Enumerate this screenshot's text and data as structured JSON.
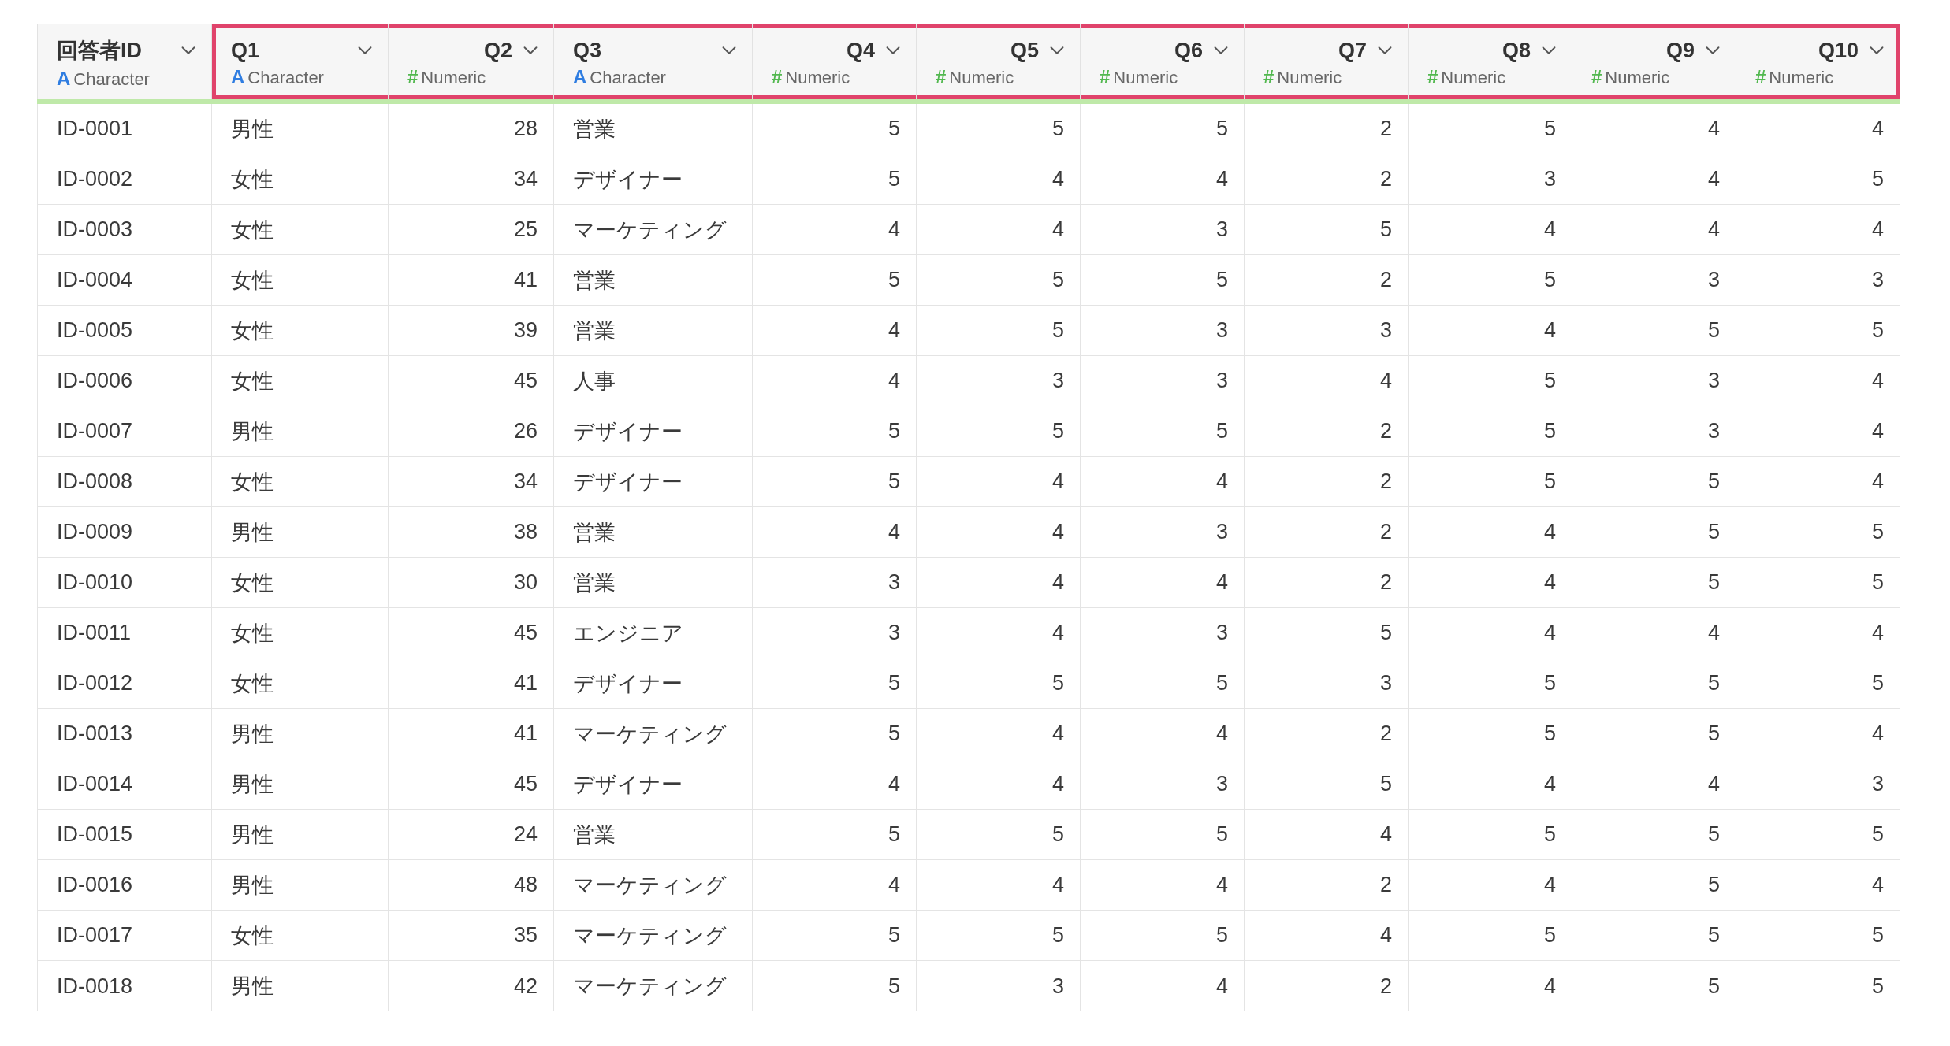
{
  "table": {
    "columns": [
      {
        "name": "回答者ID",
        "kind": "character",
        "type_icon": "A",
        "type": "Character",
        "highlighted": false
      },
      {
        "name": "Q1",
        "kind": "character",
        "type_icon": "A",
        "type": "Character",
        "highlighted": true
      },
      {
        "name": "Q2",
        "kind": "numeric",
        "type_icon": "#",
        "type": "Numeric",
        "highlighted": true
      },
      {
        "name": "Q3",
        "kind": "character",
        "type_icon": "A",
        "type": "Character",
        "highlighted": true
      },
      {
        "name": "Q4",
        "kind": "numeric",
        "type_icon": "#",
        "type": "Numeric",
        "highlighted": true
      },
      {
        "name": "Q5",
        "kind": "numeric",
        "type_icon": "#",
        "type": "Numeric",
        "highlighted": true
      },
      {
        "name": "Q6",
        "kind": "numeric",
        "type_icon": "#",
        "type": "Numeric",
        "highlighted": true
      },
      {
        "name": "Q7",
        "kind": "numeric",
        "type_icon": "#",
        "type": "Numeric",
        "highlighted": true
      },
      {
        "name": "Q8",
        "kind": "numeric",
        "type_icon": "#",
        "type": "Numeric",
        "highlighted": true
      },
      {
        "name": "Q9",
        "kind": "numeric",
        "type_icon": "#",
        "type": "Numeric",
        "highlighted": true
      },
      {
        "name": "Q10",
        "kind": "numeric",
        "type_icon": "#",
        "type": "Numeric",
        "highlighted": true
      }
    ],
    "rows": [
      [
        "ID-0001",
        "男性",
        "28",
        "営業",
        "5",
        "5",
        "5",
        "2",
        "5",
        "4",
        "4"
      ],
      [
        "ID-0002",
        "女性",
        "34",
        "デザイナー",
        "5",
        "4",
        "4",
        "2",
        "3",
        "4",
        "5"
      ],
      [
        "ID-0003",
        "女性",
        "25",
        "マーケティング",
        "4",
        "4",
        "3",
        "5",
        "4",
        "4",
        "4"
      ],
      [
        "ID-0004",
        "女性",
        "41",
        "営業",
        "5",
        "5",
        "5",
        "2",
        "5",
        "3",
        "3"
      ],
      [
        "ID-0005",
        "女性",
        "39",
        "営業",
        "4",
        "5",
        "3",
        "3",
        "4",
        "5",
        "5"
      ],
      [
        "ID-0006",
        "女性",
        "45",
        "人事",
        "4",
        "3",
        "3",
        "4",
        "5",
        "3",
        "4"
      ],
      [
        "ID-0007",
        "男性",
        "26",
        "デザイナー",
        "5",
        "5",
        "5",
        "2",
        "5",
        "3",
        "4"
      ],
      [
        "ID-0008",
        "女性",
        "34",
        "デザイナー",
        "5",
        "4",
        "4",
        "2",
        "5",
        "5",
        "4"
      ],
      [
        "ID-0009",
        "男性",
        "38",
        "営業",
        "4",
        "4",
        "3",
        "2",
        "4",
        "5",
        "5"
      ],
      [
        "ID-0010",
        "女性",
        "30",
        "営業",
        "3",
        "4",
        "4",
        "2",
        "4",
        "5",
        "5"
      ],
      [
        "ID-0011",
        "女性",
        "45",
        "エンジニア",
        "3",
        "4",
        "3",
        "5",
        "4",
        "4",
        "4"
      ],
      [
        "ID-0012",
        "女性",
        "41",
        "デザイナー",
        "5",
        "5",
        "5",
        "3",
        "5",
        "5",
        "5"
      ],
      [
        "ID-0013",
        "男性",
        "41",
        "マーケティング",
        "5",
        "4",
        "4",
        "2",
        "5",
        "5",
        "4"
      ],
      [
        "ID-0014",
        "男性",
        "45",
        "デザイナー",
        "4",
        "4",
        "3",
        "5",
        "4",
        "4",
        "3"
      ],
      [
        "ID-0015",
        "男性",
        "24",
        "営業",
        "5",
        "5",
        "5",
        "4",
        "5",
        "5",
        "5"
      ],
      [
        "ID-0016",
        "男性",
        "48",
        "マーケティング",
        "4",
        "4",
        "4",
        "2",
        "4",
        "5",
        "4"
      ],
      [
        "ID-0017",
        "女性",
        "35",
        "マーケティング",
        "5",
        "5",
        "5",
        "4",
        "5",
        "5",
        "5"
      ],
      [
        "ID-0018",
        "男性",
        "42",
        "マーケティング",
        "5",
        "3",
        "4",
        "2",
        "4",
        "5",
        "5"
      ]
    ]
  }
}
